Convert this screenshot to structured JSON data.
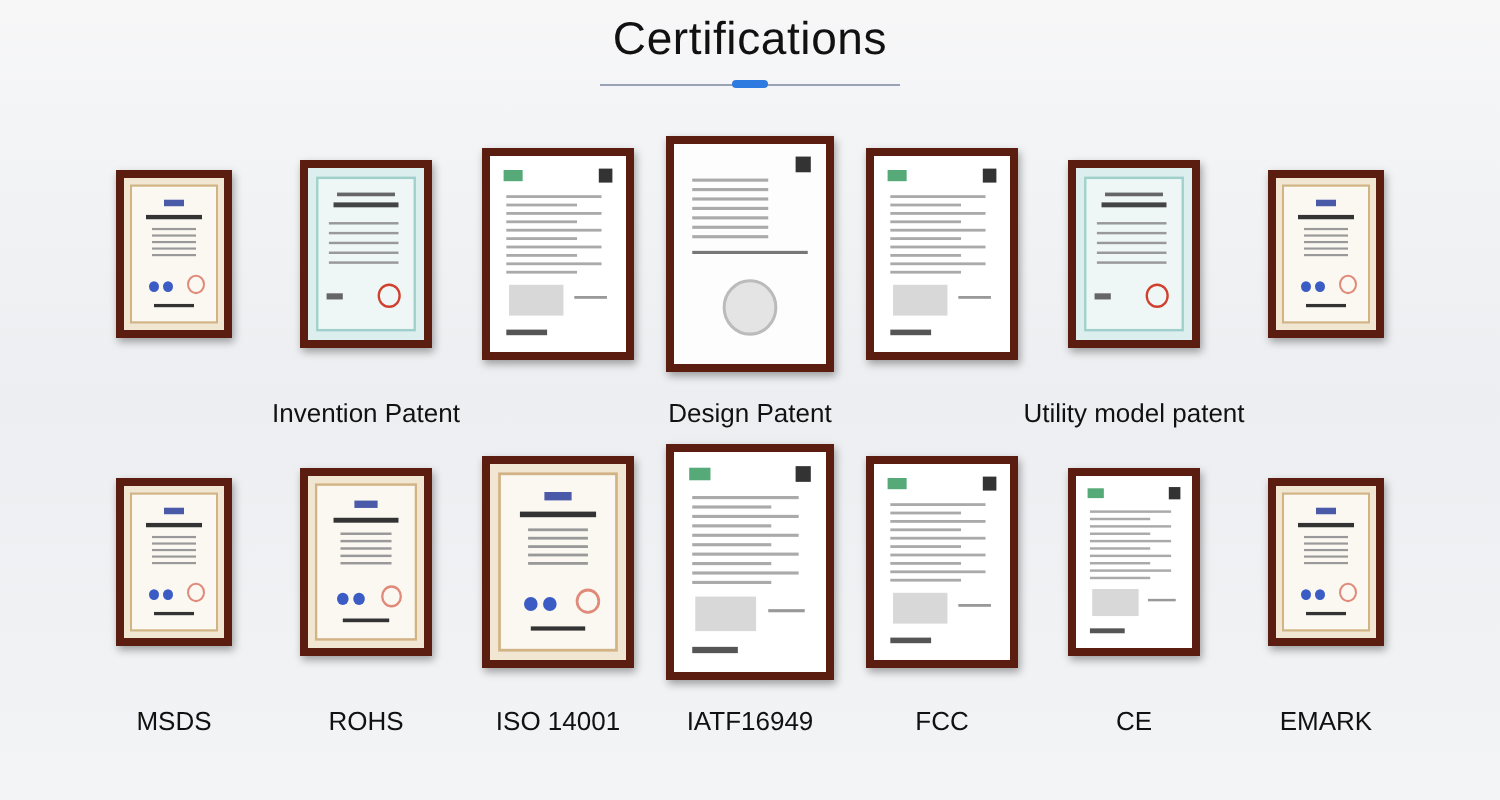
{
  "title": "Certifications",
  "rows": [
    {
      "certificates": [
        {
          "kind": "seal"
        },
        {
          "kind": "patent",
          "caption": "Invention Patent"
        },
        {
          "kind": "document"
        },
        {
          "kind": "design",
          "caption": "Design Patent"
        },
        {
          "kind": "document"
        },
        {
          "kind": "patent",
          "caption": "Utility model patent"
        },
        {
          "kind": "seal"
        }
      ]
    },
    {
      "certificates": [
        {
          "kind": "seal",
          "caption": "MSDS"
        },
        {
          "kind": "seal",
          "caption": "ROHS"
        },
        {
          "kind": "seal",
          "caption": "ISO 14001"
        },
        {
          "kind": "document",
          "caption": "IATF16949"
        },
        {
          "kind": "document",
          "caption": "FCC"
        },
        {
          "kind": "document",
          "caption": "CE"
        },
        {
          "kind": "seal",
          "caption": "EMARK"
        }
      ]
    }
  ]
}
